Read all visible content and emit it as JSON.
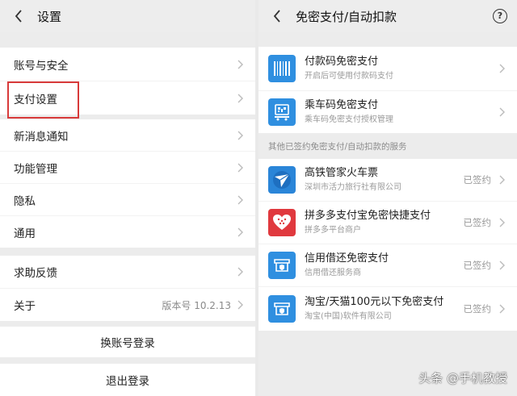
{
  "colors": {
    "accent_blue": "#2f8fe0",
    "highlight_red": "#d83a3a",
    "pdd_red": "#e0393e"
  },
  "left": {
    "title": "设置",
    "items": [
      {
        "label": "账号与安全"
      },
      {
        "label": "支付设置"
      },
      {
        "label": "新消息通知"
      },
      {
        "label": "功能管理"
      },
      {
        "label": "隐私"
      },
      {
        "label": "通用"
      },
      {
        "label": "求助反馈"
      },
      {
        "label": "关于",
        "value": "版本号 10.2.13"
      }
    ],
    "switch_account": "换账号登录",
    "logout": "退出登录"
  },
  "right": {
    "title": "免密支付/自动扣款",
    "help_icon": "?",
    "top_items": [
      {
        "title": "付款码免密支付",
        "subtitle": "开启后可使用付款码支付",
        "icon": "barcode-icon"
      },
      {
        "title": "乘车码免密支付",
        "subtitle": "乘车码免密支付授权管理",
        "icon": "qrcode-bus-icon"
      }
    ],
    "section_label": "其他已签约免密支付/自动扣款的服务",
    "services": [
      {
        "title": "高铁管家火车票",
        "subtitle": "深圳市活力旅行社有限公司",
        "status": "已签约",
        "icon": "train-app-icon"
      },
      {
        "title": "拼多多支付宝免密快捷支付",
        "subtitle": "拼多多平台商户",
        "status": "已签约",
        "icon": "pinduoduo-icon"
      },
      {
        "title": "信用借还免密支付",
        "subtitle": "信用借还服务商",
        "status": "已签约",
        "icon": "credit-borrow-icon"
      },
      {
        "title": "淘宝/天猫100元以下免密支付",
        "subtitle": "淘宝(中国)软件有限公司",
        "status": "已签约",
        "icon": "taobao-shop-icon"
      }
    ]
  },
  "watermark": "头条 @手机教授"
}
